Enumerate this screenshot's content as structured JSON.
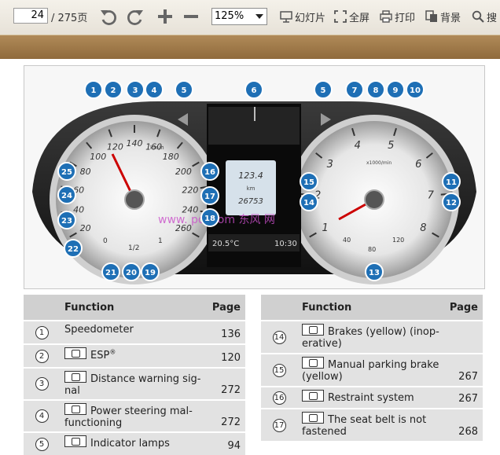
{
  "toolbar": {
    "current_page": "24",
    "total_pages": "/ 275页",
    "zoom": "125%",
    "slideshow": "幻灯片",
    "fullscreen": "全屏",
    "print": "打印",
    "background": "背景",
    "search_icon": "search-icon"
  },
  "cluster": {
    "display_trip": "123.4",
    "display_km": "km",
    "display_odo": "26753",
    "temp": "20.5°C",
    "time": "10:30",
    "watermark": "www.  pdf.com  东风 网",
    "speed_ticks": [
      "20",
      "40",
      "60",
      "80",
      "100",
      "120",
      "140",
      "160",
      "180",
      "200",
      "220",
      "240",
      "260"
    ],
    "rpm_ticks": [
      "1",
      "2",
      "3",
      "4",
      "5",
      "6",
      "7",
      "8"
    ],
    "rpm_unit": "x1000/min",
    "speed_unit": "km/h",
    "fuel_ticks": [
      "0",
      "1/2",
      "1"
    ],
    "coolant_ticks": [
      "40",
      "80",
      "120"
    ],
    "callouts": [
      "1",
      "2",
      "3",
      "4",
      "5",
      "6",
      "5",
      "7",
      "8",
      "9",
      "10",
      "11",
      "12",
      "13",
      "14",
      "15",
      "16",
      "17",
      "18",
      "19",
      "20",
      "21",
      "22",
      "23",
      "24",
      "25"
    ]
  },
  "table_left": {
    "headers": {
      "function": "Function",
      "page": "Page"
    },
    "rows": [
      {
        "num": "1",
        "text": "Speedometer",
        "page": "136"
      },
      {
        "num": "2",
        "text": "ESP",
        "sup": "®",
        "page": "120"
      },
      {
        "num": "3",
        "text": "Distance warning sig-nal",
        "page": "272"
      },
      {
        "num": "4",
        "text": "Power steering mal-functioning",
        "page": "272"
      },
      {
        "num": "5",
        "text": "Indicator lamps",
        "page": "94"
      }
    ]
  },
  "table_right": {
    "headers": {
      "function": "Function",
      "page": "Page"
    },
    "rows": [
      {
        "num": "14",
        "text": "Brakes (yellow) (inop-erative)",
        "page": ""
      },
      {
        "num": "15",
        "text": "Manual parking brake (yellow)",
        "page": "267"
      },
      {
        "num": "16",
        "text": "Restraint system",
        "page": "267"
      },
      {
        "num": "17",
        "text": "The seat belt is not fastened",
        "page": "268"
      }
    ]
  }
}
